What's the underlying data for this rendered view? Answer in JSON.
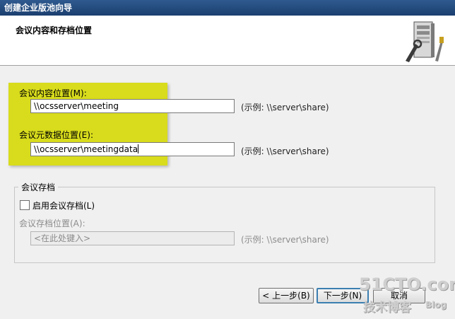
{
  "window": {
    "title": "创建企业版池向导"
  },
  "header": {
    "title": "会议内容和存档位置",
    "icon": "server-tools-icon"
  },
  "content_location": {
    "label": "会议内容位置(M):",
    "value": "\\\\ocsserver\\meeting",
    "example": "(示例: \\\\server\\share)"
  },
  "metadata_location": {
    "label": "会议元数据位置(E):",
    "value": "\\\\ocsserver\\meetingdata",
    "example": "(示例: \\\\server\\share)"
  },
  "archive": {
    "group_title": "会议存档",
    "checkbox_label": "启用会议存档(L)",
    "checked": false,
    "location_label": "会议存档位置(A):",
    "location_placeholder": "<在此处键入>",
    "example": "(示例: \\\\server\\share)"
  },
  "buttons": {
    "back": "< 上一步(B)",
    "next": "下一步(N)",
    "cancel": "取消"
  },
  "watermark": {
    "site": "51CTO.com",
    "tagline": "技术博客",
    "blog": "Blog"
  },
  "colors": {
    "highlight": "#d8dc1c",
    "titlebar": "#1b3f6f"
  }
}
